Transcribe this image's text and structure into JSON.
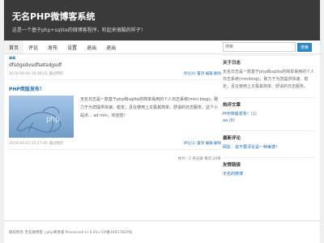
{
  "header": {
    "title": "无名PHP微博客系统",
    "subtitle": "这是一个基于php+sqlite的微博客程序，听起来很酷的样子！"
  },
  "nav": {
    "items": [
      "首页",
      "评论",
      "发布",
      "设置",
      "退出",
      "退出"
    ],
    "search_placeholder": "搜索",
    "search_button": "搜索"
  },
  "posts": [
    {
      "title": "aa",
      "body": "dfsdgsdvsdfsetsdgsdf",
      "meta_left": "2019-04-04 10:06:01 通过网页",
      "meta_right": "评论(0) 置顶 编辑 删除"
    },
    {
      "title": "PHP简版发布！",
      "excerpt": "无名日志是一款基于php和sqlite的简单易用的个人日志系统(mini blog)，致力于为您提供快速、稳定，且在使用上又极其简单、舒适的日志服务，这个小站点... ad min，欢迎您！",
      "meta_left": "2019-04-03 15:17:45 通过网页",
      "meta_right": "评论(1) 置顶 编辑 删除"
    }
  ],
  "pager": "共计：2 条记录 每页:20条",
  "sidebar": {
    "about_title": "关于日志",
    "about_text": "无名日志是一款基于php和sqlite的简单易用的个人日志系统(miniblog)，致力于为您提供快速、稳定，且在使用上又极其简单、舒适的日志服务。",
    "hot_title": "热评文章",
    "hot_items": [
      "PHP简版发布！(1)",
      "aa (0)"
    ],
    "comments_title": "最新评论",
    "comments_items": [
      "网友：说不要评论是一种美德！"
    ],
    "links_title": "友情链接",
    "links_items": [
      "无名的微博"
    ]
  },
  "footer": {
    "text": "版权所有 无名微博客 | php简易版 Processed in 0.01s ICP备16017829号"
  }
}
